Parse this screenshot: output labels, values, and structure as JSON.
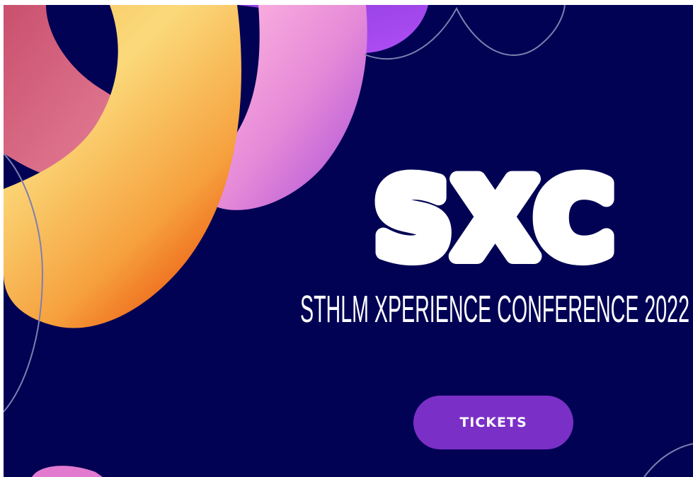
{
  "hero": {
    "logo": "SXC",
    "subtitle": "STHLM XPERIENCE CONFERENCE 2022",
    "tickets_label": "TICKETS"
  },
  "colors": {
    "background": "#010254",
    "accent": "#7a2fc6",
    "text": "#ffffff"
  }
}
